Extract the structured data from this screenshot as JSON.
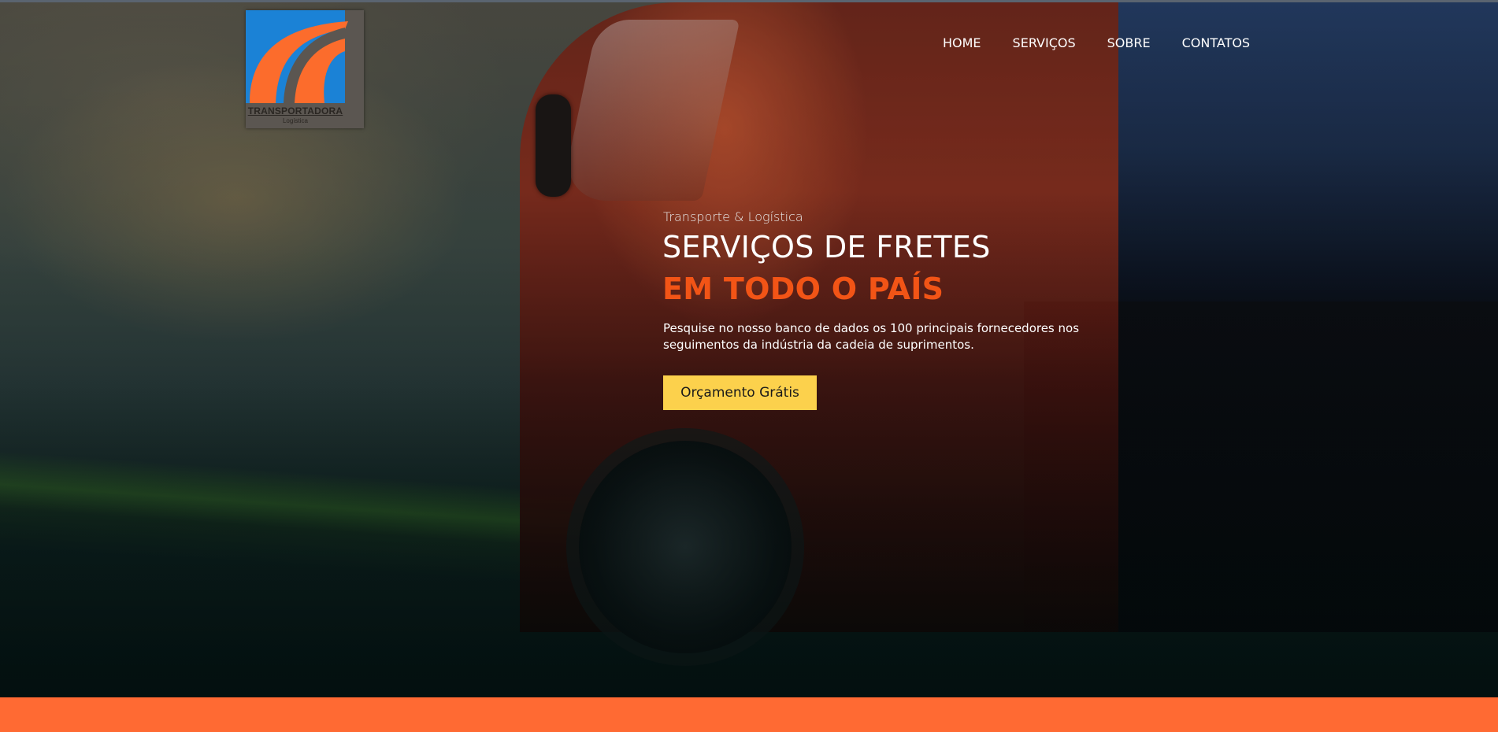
{
  "colors": {
    "accent_orange": "#ff6a33",
    "headline_orange": "#f25416",
    "cta_yellow": "#fcd14c",
    "logo_blue": "#1b82d6",
    "logo_orange": "#fc6c2c"
  },
  "logo": {
    "title": "TRANSPORTADORA",
    "subtitle": "Logística",
    "icon": "road-swoosh-logo-icon"
  },
  "nav": {
    "items": [
      {
        "label": "HOME"
      },
      {
        "label": "SERVIÇOS"
      },
      {
        "label": "SOBRE"
      },
      {
        "label": "CONTATOS"
      }
    ]
  },
  "hero": {
    "eyebrow": "Transporte & Logística",
    "headline": "SERVIÇOS DE FRETES",
    "headline_accent": "EM TODO O PAÍS",
    "lead": "Pesquise no nosso banco de dados os 100 principais fornecedores nos seguimentos da indústria da cadeia de suprimentos.",
    "cta_label": "Orçamento Grátis"
  }
}
